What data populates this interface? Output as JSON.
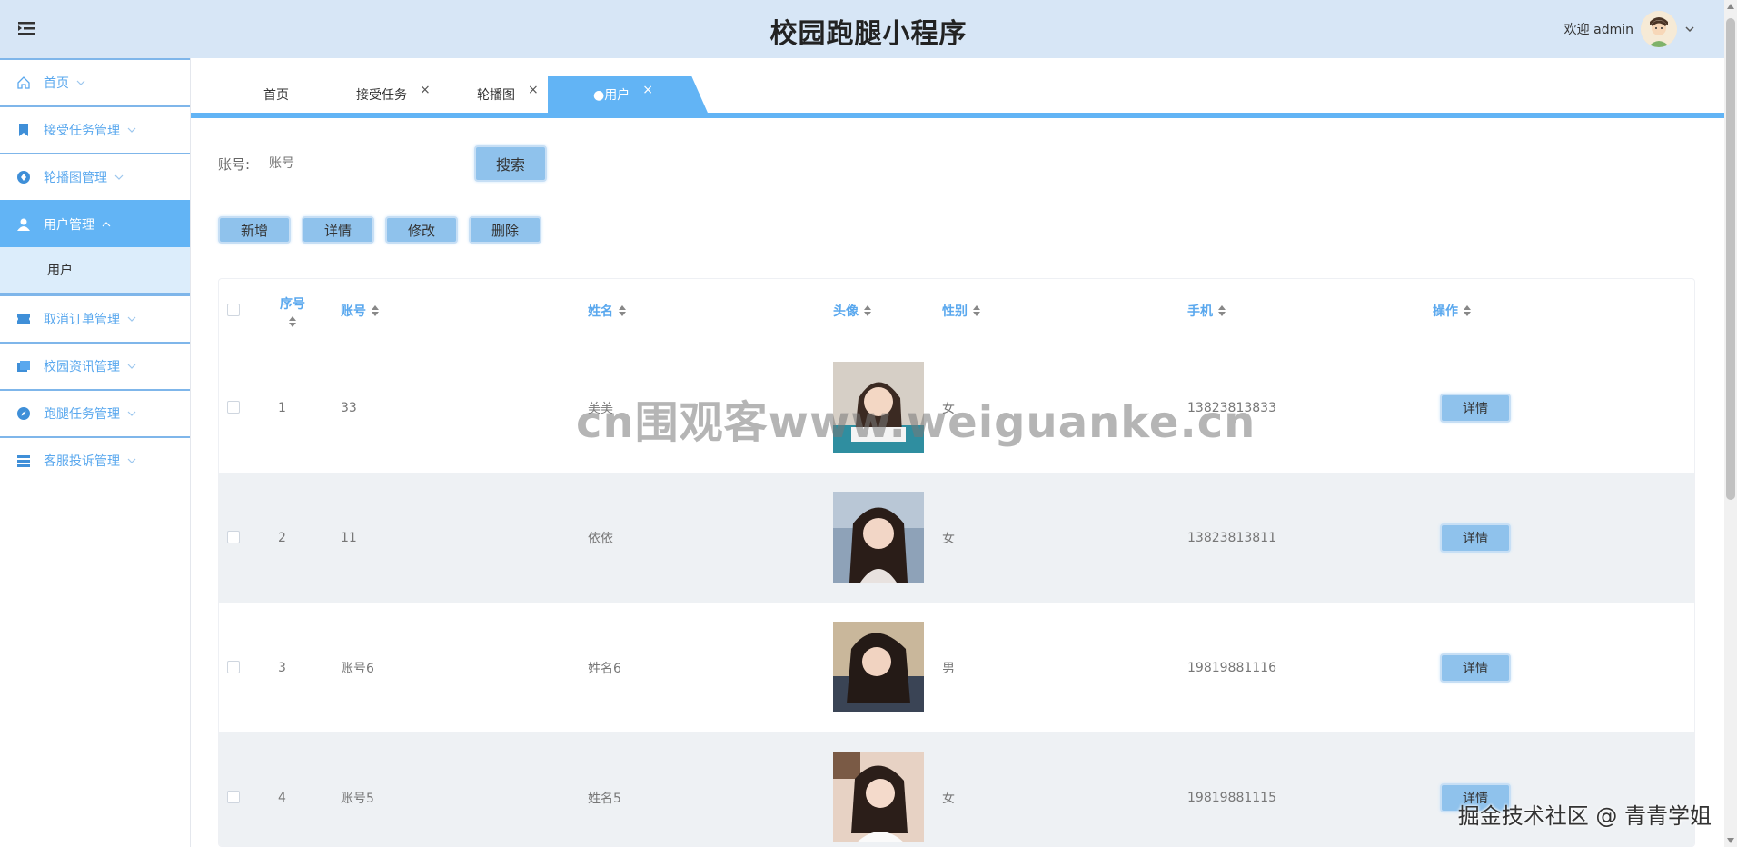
{
  "header": {
    "title": "校园跑腿小程序",
    "welcome": "欢迎 admin"
  },
  "sidebar": {
    "items": [
      {
        "label": "首页",
        "icon": "home-icon"
      },
      {
        "label": "接受任务管理",
        "icon": "bookmark-icon"
      },
      {
        "label": "轮播图管理",
        "icon": "carousel-icon"
      },
      {
        "label": "用户管理",
        "icon": "user-icon",
        "active": true
      },
      {
        "label": "取消订单管理",
        "icon": "ticket-icon"
      },
      {
        "label": "校园资讯管理",
        "icon": "news-icon"
      },
      {
        "label": "跑腿任务管理",
        "icon": "compass-icon"
      },
      {
        "label": "客服投诉管理",
        "icon": "list-icon"
      }
    ],
    "sub_item": "用户"
  },
  "tabs": [
    {
      "label": "首页"
    },
    {
      "label": "接受任务",
      "close": "×"
    },
    {
      "label": "轮播图",
      "close": "×"
    },
    {
      "label": "●用户",
      "close": "×",
      "active": true
    }
  ],
  "search": {
    "label": "账号:",
    "placeholder": "账号",
    "button": "搜索"
  },
  "actions": {
    "add": "新增",
    "detail": "详情",
    "edit": "修改",
    "delete": "删除"
  },
  "table": {
    "headers": {
      "index": "序号",
      "account": "账号",
      "name": "姓名",
      "avatar": "头像",
      "gender": "性别",
      "phone": "手机",
      "op": "操作"
    },
    "row_button": "详情",
    "rows": [
      {
        "index": "1",
        "account": "33",
        "name": "美美",
        "gender": "女",
        "phone": "13823813833"
      },
      {
        "index": "2",
        "account": "11",
        "name": "依依",
        "gender": "女",
        "phone": "13823813811"
      },
      {
        "index": "3",
        "account": "账号6",
        "name": "姓名6",
        "gender": "男",
        "phone": "19819881116"
      },
      {
        "index": "4",
        "account": "账号5",
        "name": "姓名5",
        "gender": "女",
        "phone": "19819881115"
      }
    ]
  },
  "watermarks": {
    "center": "cn围观客www.weiguanke.cn",
    "corner": "掘金技术社区 @ 青青学姐"
  },
  "colors": {
    "header_bg": "#d7e6f6",
    "accent": "#62b4f5",
    "button": "#8fc2ec"
  }
}
